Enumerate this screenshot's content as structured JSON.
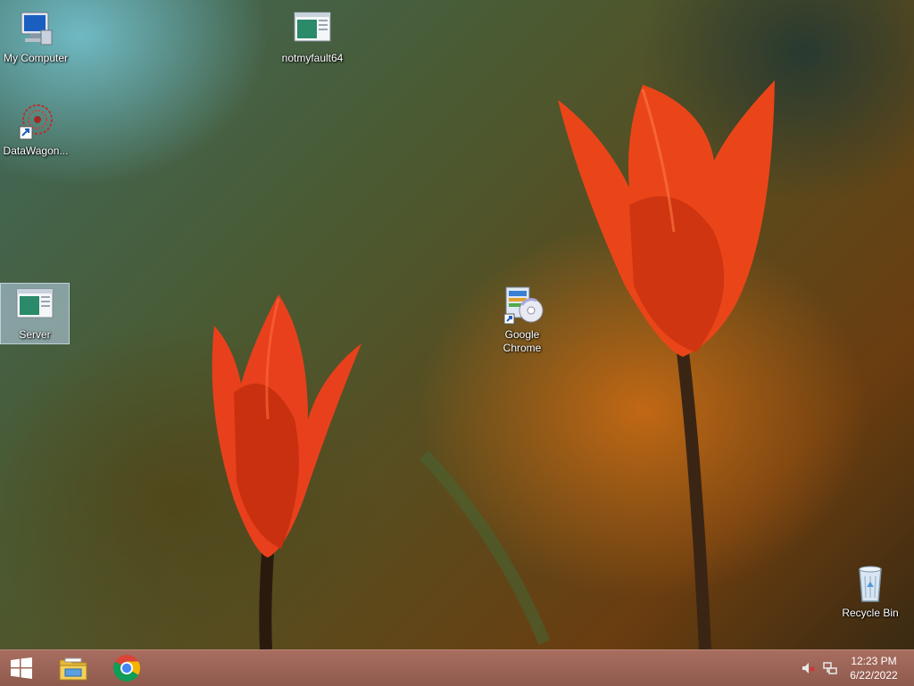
{
  "desktop": {
    "icons": [
      {
        "label": "My Computer",
        "icon": "computer-icon"
      },
      {
        "label": "notmyfault64",
        "icon": "app-window-icon"
      },
      {
        "label": "DataWagon...",
        "icon": "datawagon-icon"
      },
      {
        "label": "Server",
        "icon": "app-window-icon",
        "selected": true
      },
      {
        "label": "Google\nChrome",
        "icon": "installer-icon"
      },
      {
        "label": "Recycle Bin",
        "icon": "recycle-bin-icon"
      }
    ]
  },
  "taskbar": {
    "pinned": [
      "start-button",
      "file-explorer-icon",
      "chrome-icon"
    ],
    "tray": {
      "volume": "volume-muted-icon",
      "network": "network-icon"
    },
    "clock": {
      "time": "12:23 PM",
      "date": "6/22/2022"
    }
  },
  "colors": {
    "taskbar": "#9a6456",
    "tulip": "#e8401c",
    "selection": "#bed7f0"
  }
}
